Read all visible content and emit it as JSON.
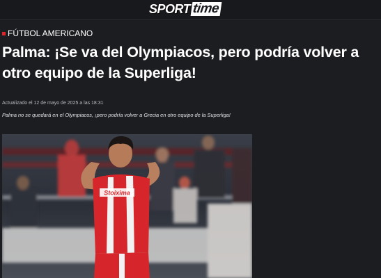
{
  "header": {
    "logo_part1": "SPORT",
    "logo_part2": "time"
  },
  "article": {
    "category": "FÚTBOL AMERICANO",
    "title": "Palma: ¡Se va del Olympiacos, pero podría volver a otro equipo de la Superliga!",
    "updated": "Actualizado el 12 de mayo de 2025 a las 18:31",
    "summary": "Palma no se quedará en el Olympiacos, ¡pero podría volver a Grecia en otro equipo de la Superliga!",
    "image": {
      "jersey_sponsor": "Stoiximan",
      "icon": "player-photo-icon"
    }
  },
  "colors": {
    "background": "#1c1d21",
    "accent": "#e2232a",
    "text": "#ffffff"
  }
}
